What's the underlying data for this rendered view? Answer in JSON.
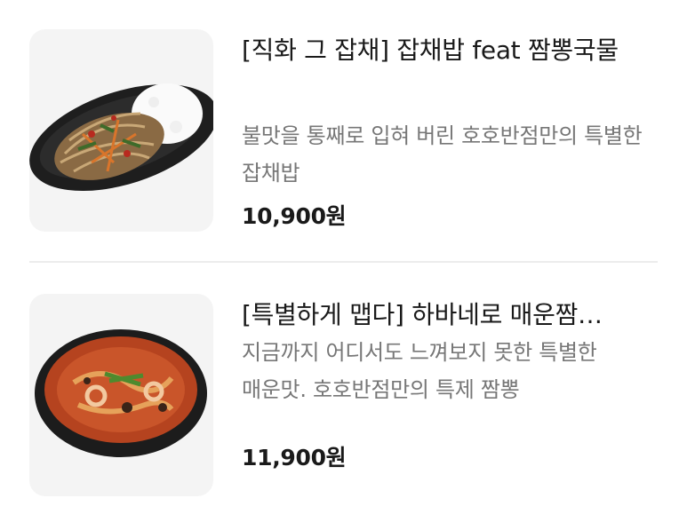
{
  "menu_items": [
    {
      "title": "[직화 그 잡채] 잡채밥 feat 짬뽕국물",
      "description": "불맛을 통째로 입혀 버린 호호반점만의 특별한 잡채밥",
      "price": "10,900원",
      "image_icon": "japchae-rice-dish"
    },
    {
      "title": "[특별하게 맵다] 하바네로 매운짬…",
      "description": "지금까지 어디서도 느껴보지 못한 특별한 매운맛. 호호반점만의 특제 짬뽕",
      "price": "11,900원",
      "image_icon": "spicy-jjamppong-bowl"
    }
  ]
}
